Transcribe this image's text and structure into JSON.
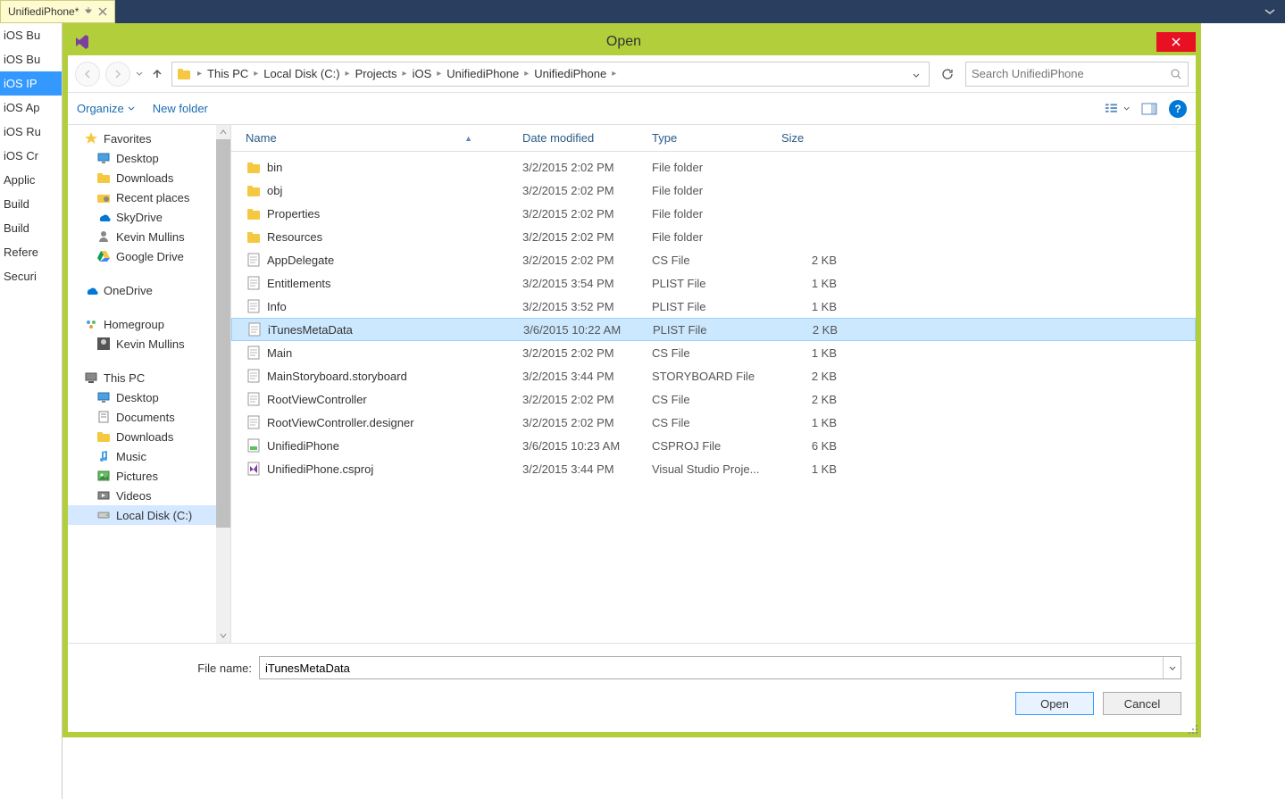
{
  "tab": {
    "title": "UnifiediPhone*"
  },
  "vs_sidebar": [
    {
      "label": "iOS Bu",
      "selected": false
    },
    {
      "label": "iOS Bu",
      "selected": false
    },
    {
      "label": "iOS IP",
      "selected": true
    },
    {
      "label": "iOS Ap",
      "selected": false
    },
    {
      "label": "iOS Ru",
      "selected": false
    },
    {
      "label": "iOS Cr",
      "selected": false
    },
    {
      "label": "Applic",
      "selected": false
    },
    {
      "label": "Build",
      "selected": false
    },
    {
      "label": "Build",
      "selected": false
    },
    {
      "label": "Refere",
      "selected": false
    },
    {
      "label": "Securi",
      "selected": false
    }
  ],
  "dialog": {
    "title": "Open",
    "breadcrumb": [
      "This PC",
      "Local Disk (C:)",
      "Projects",
      "iOS",
      "UnifiediPhone",
      "UnifiediPhone"
    ],
    "search_placeholder": "Search UnifiediPhone",
    "organize_label": "Organize",
    "newfolder_label": "New folder",
    "filename_label": "File name:",
    "filename_value": "iTunesMetaData",
    "open_label": "Open",
    "cancel_label": "Cancel",
    "columns": {
      "name": "Name",
      "date": "Date modified",
      "type": "Type",
      "size": "Size"
    }
  },
  "tree": {
    "favorites": {
      "label": "Favorites",
      "items": [
        "Desktop",
        "Downloads",
        "Recent places",
        "SkyDrive",
        "Kevin Mullins",
        "Google Drive"
      ]
    },
    "onedrive": {
      "label": "OneDrive"
    },
    "homegroup": {
      "label": "Homegroup",
      "items": [
        "Kevin Mullins"
      ]
    },
    "thispc": {
      "label": "This PC",
      "items": [
        "Desktop",
        "Documents",
        "Downloads",
        "Music",
        "Pictures",
        "Videos",
        "Local Disk (C:)"
      ]
    }
  },
  "files": [
    {
      "name": "bin",
      "date": "3/2/2015 2:02 PM",
      "type": "File folder",
      "size": "",
      "icon": "folder",
      "selected": false
    },
    {
      "name": "obj",
      "date": "3/2/2015 2:02 PM",
      "type": "File folder",
      "size": "",
      "icon": "folder",
      "selected": false
    },
    {
      "name": "Properties",
      "date": "3/2/2015 2:02 PM",
      "type": "File folder",
      "size": "",
      "icon": "folder",
      "selected": false
    },
    {
      "name": "Resources",
      "date": "3/2/2015 2:02 PM",
      "type": "File folder",
      "size": "",
      "icon": "folder",
      "selected": false
    },
    {
      "name": "AppDelegate",
      "date": "3/2/2015 2:02 PM",
      "type": "CS File",
      "size": "2 KB",
      "icon": "file",
      "selected": false
    },
    {
      "name": "Entitlements",
      "date": "3/2/2015 3:54 PM",
      "type": "PLIST File",
      "size": "1 KB",
      "icon": "file",
      "selected": false
    },
    {
      "name": "Info",
      "date": "3/2/2015 3:52 PM",
      "type": "PLIST File",
      "size": "1 KB",
      "icon": "file",
      "selected": false
    },
    {
      "name": "iTunesMetaData",
      "date": "3/6/2015 10:22 AM",
      "type": "PLIST File",
      "size": "2 KB",
      "icon": "file",
      "selected": true
    },
    {
      "name": "Main",
      "date": "3/2/2015 2:02 PM",
      "type": "CS File",
      "size": "1 KB",
      "icon": "file",
      "selected": false
    },
    {
      "name": "MainStoryboard.storyboard",
      "date": "3/2/2015 3:44 PM",
      "type": "STORYBOARD File",
      "size": "2 KB",
      "icon": "file",
      "selected": false
    },
    {
      "name": "RootViewController",
      "date": "3/2/2015 2:02 PM",
      "type": "CS File",
      "size": "2 KB",
      "icon": "file",
      "selected": false
    },
    {
      "name": "RootViewController.designer",
      "date": "3/2/2015 2:02 PM",
      "type": "CS File",
      "size": "1 KB",
      "icon": "file",
      "selected": false
    },
    {
      "name": "UnifiediPhone",
      "date": "3/6/2015 10:23 AM",
      "type": "CSPROJ File",
      "size": "6 KB",
      "icon": "csproj",
      "selected": false
    },
    {
      "name": "UnifiediPhone.csproj",
      "date": "3/2/2015 3:44 PM",
      "type": "Visual Studio Proje...",
      "size": "1 KB",
      "icon": "vsproj",
      "selected": false
    }
  ]
}
